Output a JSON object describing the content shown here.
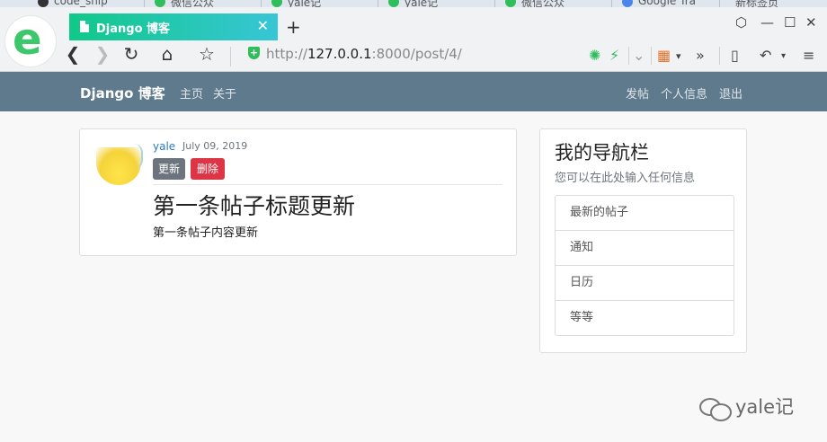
{
  "browser": {
    "background_tabs": [
      {
        "label": "code_snip"
      },
      {
        "label": "微信公众"
      },
      {
        "label": "yale记"
      },
      {
        "label": "yale记"
      },
      {
        "label": "微信公众"
      },
      {
        "label": "Google Tra"
      },
      {
        "label": "新标签页"
      }
    ],
    "active_tab_title": "Django 博客",
    "url_prefix": "http://",
    "url_host": "127.0.0.1",
    "url_rest": ":8000/post/4/",
    "icons": [
      "back-icon",
      "forward-icon",
      "reload-icon",
      "home-icon",
      "star-icon",
      "shield-icon",
      "refresh-green-icon",
      "lightning-icon",
      "chevron-down-icon",
      "apps-icon",
      "more-icon",
      "mobile-icon",
      "undo-icon",
      "menu-icon"
    ]
  },
  "navbar": {
    "brand": "Django 博客",
    "left_links": [
      "主页",
      "关于"
    ],
    "right_links": [
      "发帖",
      "个人信息",
      "退出"
    ],
    "color": "#5f7a8c"
  },
  "post": {
    "author": "yale",
    "date": "July 09, 2019",
    "update_label": "更新",
    "delete_label": "删除",
    "title": "第一条帖子标题更新",
    "content": "第一条帖子内容更新"
  },
  "sidebar": {
    "title": "我的导航栏",
    "subtitle": "您可以在此处输入任何信息",
    "items": [
      "最新的帖子",
      "通知",
      "日历",
      "等等"
    ]
  },
  "watermark": "yale记"
}
